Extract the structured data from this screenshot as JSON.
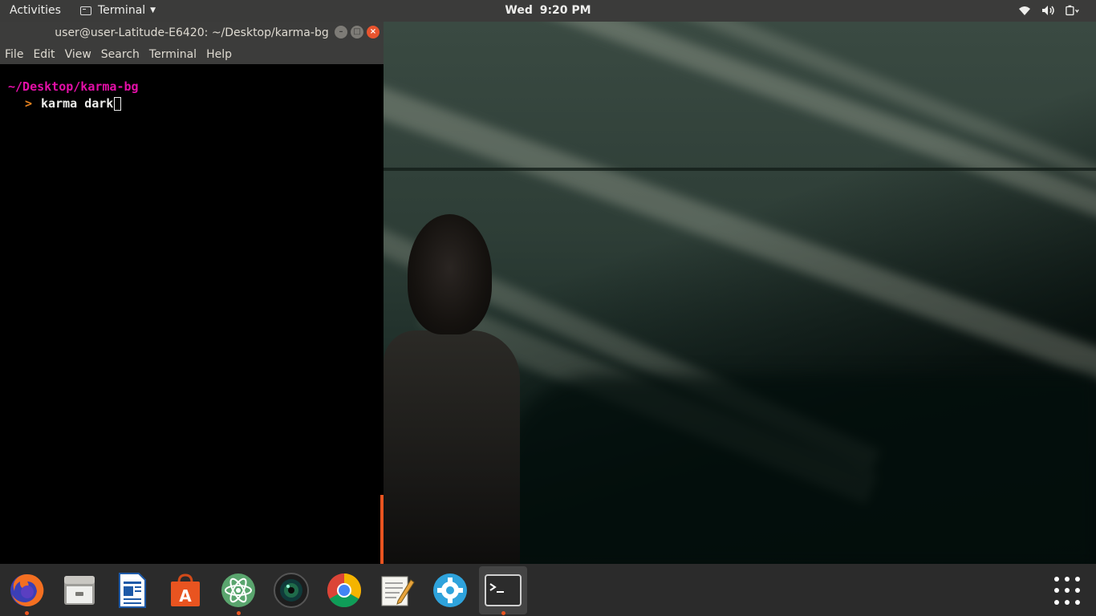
{
  "top_bar": {
    "activities": "Activities",
    "app_menu": "Terminal",
    "clock_day": "Wed",
    "clock_time": "9:20 PM",
    "tray_icons": [
      "wifi-icon",
      "volume-icon",
      "battery-icon"
    ]
  },
  "terminal": {
    "title": "user@user-Latitude-E6420: ~/Desktop/karma-bg",
    "menu": [
      "File",
      "Edit",
      "View",
      "Search",
      "Terminal",
      "Help"
    ],
    "cwd": "~/Desktop/karma-bg",
    "prompt_symbol": ">",
    "command": "karma dark"
  },
  "dock": {
    "apps": [
      "firefox",
      "files",
      "libreoffice-writer",
      "ubuntu-software",
      "atom",
      "camera",
      "chrome",
      "text-editor",
      "settings",
      "terminal"
    ],
    "running": [
      "firefox",
      "atom",
      "terminal"
    ]
  },
  "colors": {
    "accent": "#e95420",
    "cwd": "#e30fa7",
    "prompt": "#e8831f"
  }
}
